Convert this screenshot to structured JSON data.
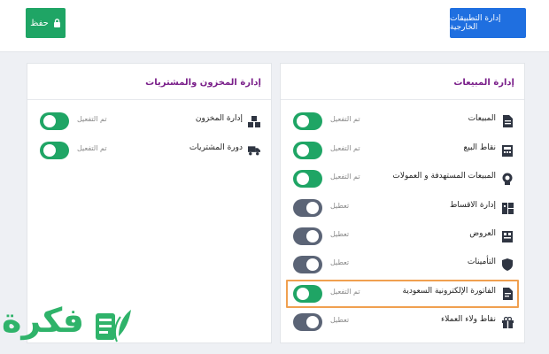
{
  "header": {
    "save_label": "حفظ",
    "external_apps_label": "إدارة التطبيقات الخارجية"
  },
  "sales_card": {
    "title": "إدارة المبيعات",
    "items": [
      {
        "label": "المبيعات",
        "status": "تم التفعيل",
        "enabled": true,
        "icon": "document-icon"
      },
      {
        "label": "نقاط البيع",
        "status": "تم التفعيل",
        "enabled": true,
        "icon": "pos-icon"
      },
      {
        "label": "المبيعات المستهدفة و العمولات",
        "status": "تم التفعيل",
        "enabled": true,
        "icon": "target-icon"
      },
      {
        "label": "إدارة الاقساط",
        "status": "تعطيل",
        "enabled": false,
        "icon": "installments-icon"
      },
      {
        "label": "العروض",
        "status": "تعطيل",
        "enabled": false,
        "icon": "offers-icon"
      },
      {
        "label": "التأمينات",
        "status": "تعطيل",
        "enabled": false,
        "icon": "shield-icon"
      },
      {
        "label": "الفاتورة الإلكترونية السعودية",
        "status": "تم التفعيل",
        "enabled": true,
        "icon": "invoice-icon",
        "highlighted": true
      },
      {
        "label": "نقاط ولاء العملاء",
        "status": "تعطيل",
        "enabled": false,
        "icon": "gift-icon"
      }
    ]
  },
  "inventory_card": {
    "title": "إدارة المخزون والمشتريات",
    "items": [
      {
        "label": "إدارة المخزون",
        "status": "تم التفعيل",
        "enabled": true,
        "icon": "boxes-icon"
      },
      {
        "label": "دورة المشتريات",
        "status": "تم التفعيل",
        "enabled": true,
        "icon": "truck-icon"
      }
    ]
  },
  "watermark": {
    "text": "فكرة"
  },
  "colors": {
    "green": "#1fa565",
    "blue": "#1f6fe0",
    "toggle_off": "#5b6476",
    "title_purple": "#7a1f8a",
    "highlight": "#f0a050"
  }
}
